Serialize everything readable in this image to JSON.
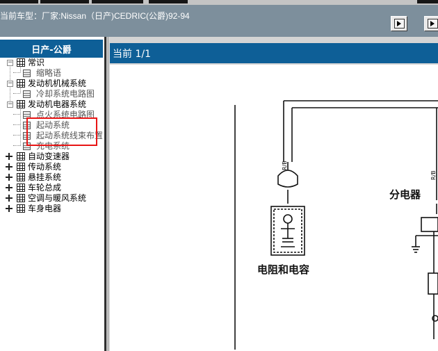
{
  "header": {
    "car_type": "当前车型：厂家:Nissan（日产)CEDRIC(公爵)92-94"
  },
  "sidebar": {
    "title": "日产-公爵",
    "tree": [
      {
        "label": "常识",
        "state": "expanded",
        "children": [
          {
            "label": "缩略语"
          }
        ]
      },
      {
        "label": "发动机机械系统",
        "state": "expanded",
        "children": [
          {
            "label": "冷却系统电路图"
          }
        ]
      },
      {
        "label": "发动机电器系统",
        "state": "expanded",
        "children": [
          {
            "label": "点火系统电路图",
            "selected": true
          },
          {
            "label": "起动系统"
          },
          {
            "label": "起动系统线束布置"
          },
          {
            "label": "充电系统"
          }
        ]
      },
      {
        "label": "自动变速器",
        "state": "collapsed"
      },
      {
        "label": "传动系统",
        "state": "collapsed"
      },
      {
        "label": "悬挂系统",
        "state": "collapsed"
      },
      {
        "label": "车轮总成",
        "state": "collapsed"
      },
      {
        "label": "空调与暖风系统",
        "state": "collapsed"
      },
      {
        "label": "车身电器",
        "state": "collapsed"
      }
    ]
  },
  "main": {
    "page_indicator": "当前 1/1",
    "diagram": {
      "labels": {
        "resistor_capacitor": "电阻和电容",
        "distributor": "分电器",
        "wire_1": "R/B",
        "wire_2": "R/B"
      }
    }
  },
  "colors": {
    "accent": "#0e5f97",
    "header_bg": "#7d8f9c",
    "highlight": "#e81414"
  },
  "icons": {
    "nav_next": "next-page-icon",
    "nav_last": "last-page-icon",
    "folder": "book-icon",
    "document": "document-icon"
  }
}
